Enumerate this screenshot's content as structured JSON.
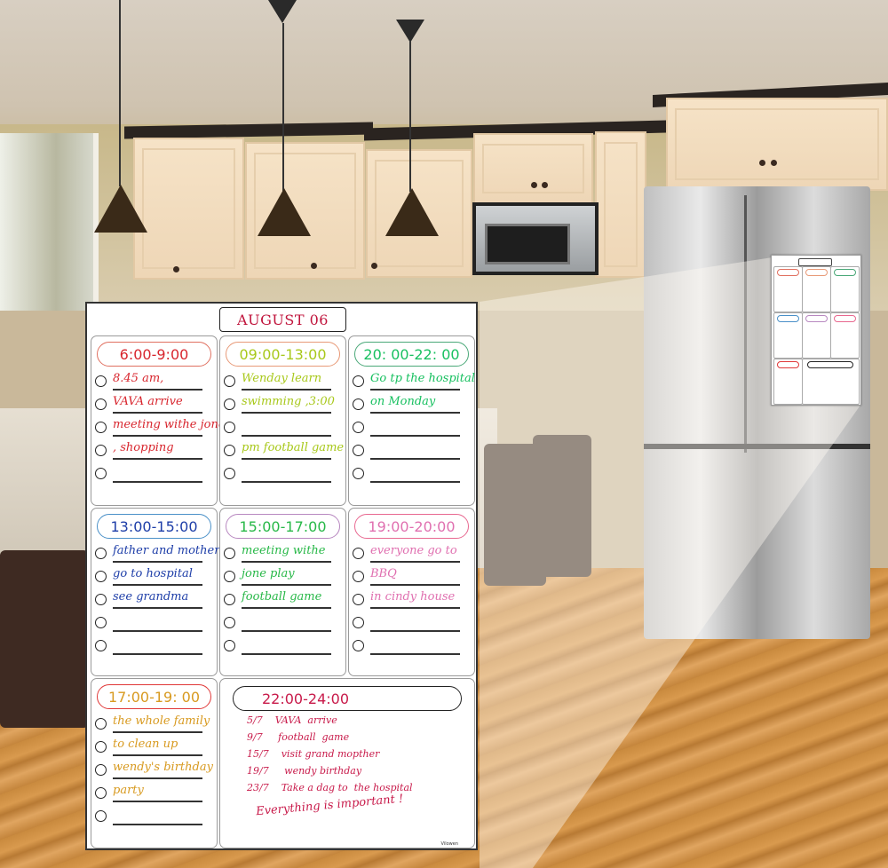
{
  "scene": {
    "description": "Kitchen with stainless steel refrigerator and a magnetic daily planner whiteboard shown enlarged in the foreground",
    "colors": {
      "accent_title": "#c0143c",
      "cabinet": "#f1dcbd",
      "floor": "#cd8e42"
    }
  },
  "board": {
    "title": "AUGUST 06",
    "brand": "Vilowen",
    "slots": [
      {
        "time": "6:00-9:00",
        "color": "#d8262e",
        "border": "#e07060",
        "items": [
          "8.45 am,",
          "VAVA arrive",
          "meeting withe jone",
          ", shopping",
          ""
        ]
      },
      {
        "time": "09:00-13:00",
        "color": "#a8c81a",
        "border": "#e89a78",
        "items": [
          "Wenday learn",
          "swimming ,3:00",
          "",
          "pm  football game",
          ""
        ]
      },
      {
        "time": "20: 00-22: 00",
        "color": "#18c060",
        "border": "#4aa878",
        "items": [
          "Go tp the hospital",
          "on Monday",
          "",
          "",
          ""
        ]
      },
      {
        "time": "13:00-15:00",
        "color": "#1e3ea8",
        "border": "#4a90c8",
        "items": [
          "father and mother",
          "go to hospital",
          "see grandma",
          "",
          ""
        ]
      },
      {
        "time": "15:00-17:00",
        "color": "#28b848",
        "border": "#b888c0",
        "items": [
          "meeting withe",
          "jone play",
          "football game",
          "",
          ""
        ]
      },
      {
        "time": "19:00-20:00",
        "color": "#e070b0",
        "border": "#e86890",
        "items": [
          "everyone go to",
          "BBQ",
          "in cindy  house",
          "",
          ""
        ]
      },
      {
        "time": "17:00-19: 00",
        "color": "#d89a20",
        "border": "#e03838",
        "items": [
          "the whole family",
          "to clean up",
          "wendy's birthday",
          "party",
          ""
        ]
      }
    ],
    "notes_section": {
      "time": "22:00-24:00",
      "color": "#c81a4a",
      "border": "#222222",
      "notes": [
        "5/7    VAVA  arrive",
        "9/7     football  game",
        "15/7    visit grand mopther",
        "19/7     wendy birthday",
        "23/7    Take a dag to  the hospital"
      ],
      "footer": "Everything is important !"
    }
  }
}
